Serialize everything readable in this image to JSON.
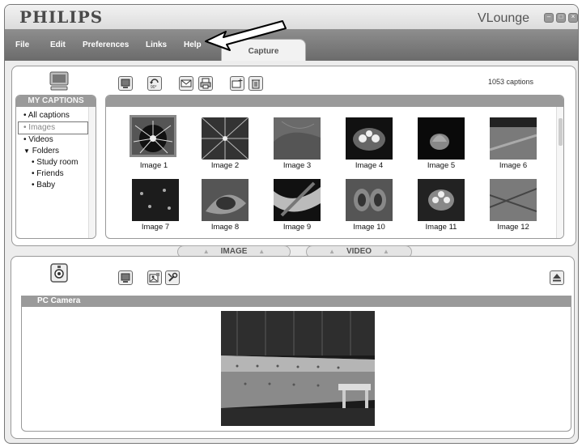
{
  "brand": "PHILIPS",
  "app_title": "VLounge",
  "window_buttons": [
    "–",
    "□",
    "×"
  ],
  "menu": [
    "File",
    "Edit",
    "Preferences",
    "Links",
    "Help"
  ],
  "active_tab": "Capture",
  "toolbar_icons": [
    "display-icon",
    "rotate-90-icon",
    "mail-icon",
    "print-icon",
    "new-folder-icon",
    "trash-icon"
  ],
  "captions_count": "1053 captions",
  "sidebar": {
    "header": "MY CAPTIONS",
    "items": [
      {
        "label": "All captions",
        "marker": "•"
      },
      {
        "label": "Images",
        "marker": "•",
        "selected": true
      },
      {
        "label": "Videos",
        "marker": "•"
      },
      {
        "label": "Folders",
        "marker": "▼"
      },
      {
        "label": "Study room",
        "marker": "•",
        "sub": true
      },
      {
        "label": "Friends",
        "marker": "•",
        "sub": true
      },
      {
        "label": "Baby",
        "marker": "•",
        "sub": true
      }
    ]
  },
  "images": [
    "Image 1",
    "Image 2",
    "Image 3",
    "Image 4",
    "Image 5",
    "Image 6",
    "Image 7",
    "Image 8",
    "Image 9",
    "Image 10",
    "Image 11",
    "Image 12"
  ],
  "mode_tabs": [
    "IMAGE",
    "VIDEO"
  ],
  "camera": {
    "header": "PC Camera"
  },
  "rotate_label": "90°"
}
